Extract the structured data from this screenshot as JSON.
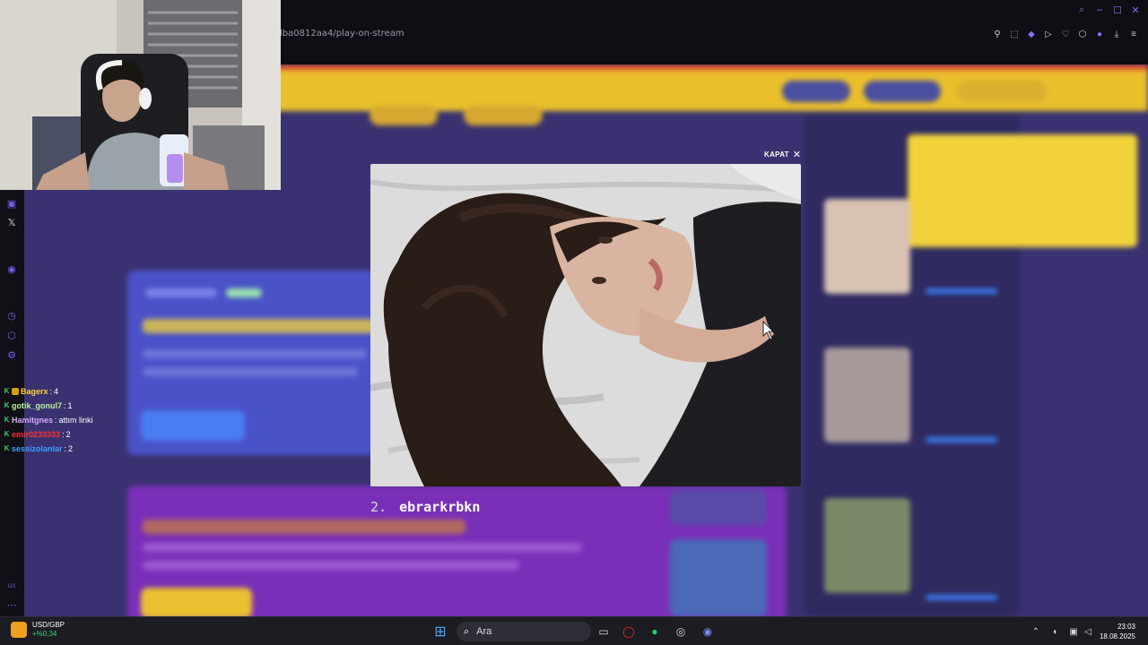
{
  "browser": {
    "url": "lba0812aa4/play-on-stream"
  },
  "modal": {
    "close_label": "KAPAT",
    "entry_number": "2.",
    "entry_name": "ebrarkrbkn"
  },
  "chat": {
    "messages": [
      {
        "user": "Bagerx",
        "text": "4",
        "color": "#ffd23a",
        "emote": true
      },
      {
        "user": "gotik_gonul7",
        "text": "1",
        "color": "#b9f2a0",
        "emote": false
      },
      {
        "user": "Hamitgnes",
        "text": "attım linki",
        "color": "#d9a6ff",
        "emote": false
      },
      {
        "user": "emir0233333",
        "text": "2",
        "color": "#ff3030",
        "emote": false
      },
      {
        "user": "sessizolanlar",
        "text": "2",
        "color": "#3aa0ff",
        "emote": false
      }
    ]
  },
  "taskbar": {
    "ticker": "USD/GBP",
    "ticker_change": "+%0,34",
    "search_placeholder": "Ara",
    "time": "23:03",
    "date": "18.08.2025"
  },
  "colors": {
    "accent": "#8b6cf2",
    "positive": "#3ad27a",
    "page_bg": "#3a3270",
    "banner": "#e9bf2c"
  }
}
